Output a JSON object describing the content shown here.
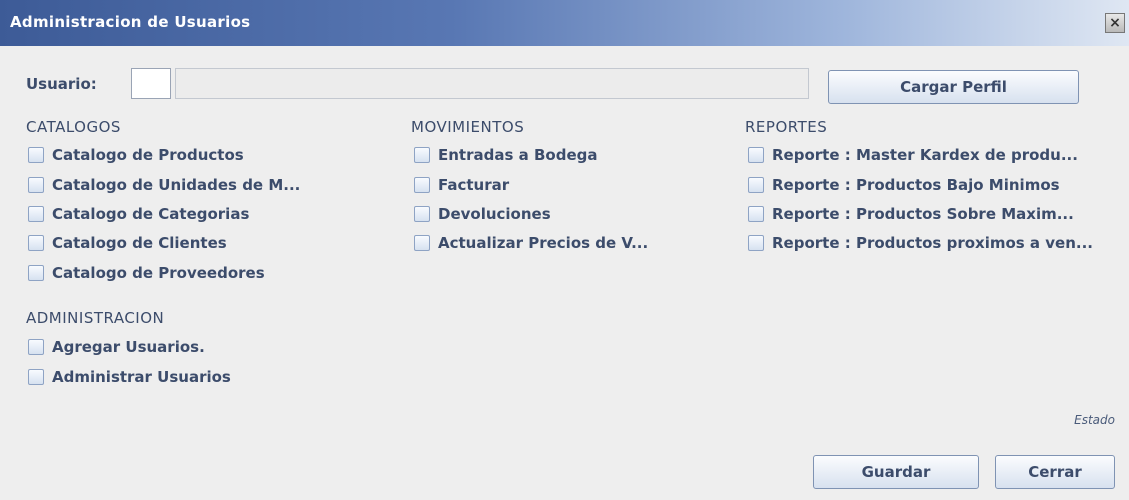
{
  "window": {
    "title": "Administracion de Usuarios",
    "close_glyph": "×"
  },
  "user": {
    "label": "Usuario:",
    "value": "",
    "load_profile_label": "Cargar Perfil"
  },
  "sections": {
    "catalogos": {
      "title": "CATALOGOS",
      "items": [
        {
          "label": "Catalogo de Productos",
          "checked": false
        },
        {
          "label": "Catalogo de Unidades de M...",
          "checked": false
        },
        {
          "label": "Catalogo de Categorias",
          "checked": false
        },
        {
          "label": "Catalogo de Clientes",
          "checked": false
        },
        {
          "label": "Catalogo de Proveedores",
          "checked": false
        }
      ]
    },
    "movimientos": {
      "title": "MOVIMIENTOS",
      "items": [
        {
          "label": "Entradas a Bodega",
          "checked": false
        },
        {
          "label": "Facturar",
          "checked": false
        },
        {
          "label": "Devoluciones",
          "checked": false
        },
        {
          "label": "Actualizar Precios de V...",
          "checked": false
        }
      ]
    },
    "reportes": {
      "title": "REPORTES",
      "items": [
        {
          "label": "Reporte : Master Kardex de produ...",
          "checked": false
        },
        {
          "label": "Reporte : Productos Bajo Minimos",
          "checked": false
        },
        {
          "label": "Reporte : Productos Sobre Maxim...",
          "checked": false
        },
        {
          "label": "Reporte : Productos proximos a ven...",
          "checked": false
        }
      ]
    },
    "administracion": {
      "title": "ADMINISTRACION",
      "items": [
        {
          "label": "Agregar Usuarios.",
          "checked": false
        },
        {
          "label": "Administrar Usuarios",
          "checked": false
        }
      ]
    }
  },
  "status_text": "Estado",
  "buttons": {
    "save_label": "Guardar",
    "close_label": "Cerrar"
  },
  "colors": {
    "titlebar_start": "#3d5b97",
    "background": "#eeeeee",
    "text": "#3c4c6b"
  }
}
